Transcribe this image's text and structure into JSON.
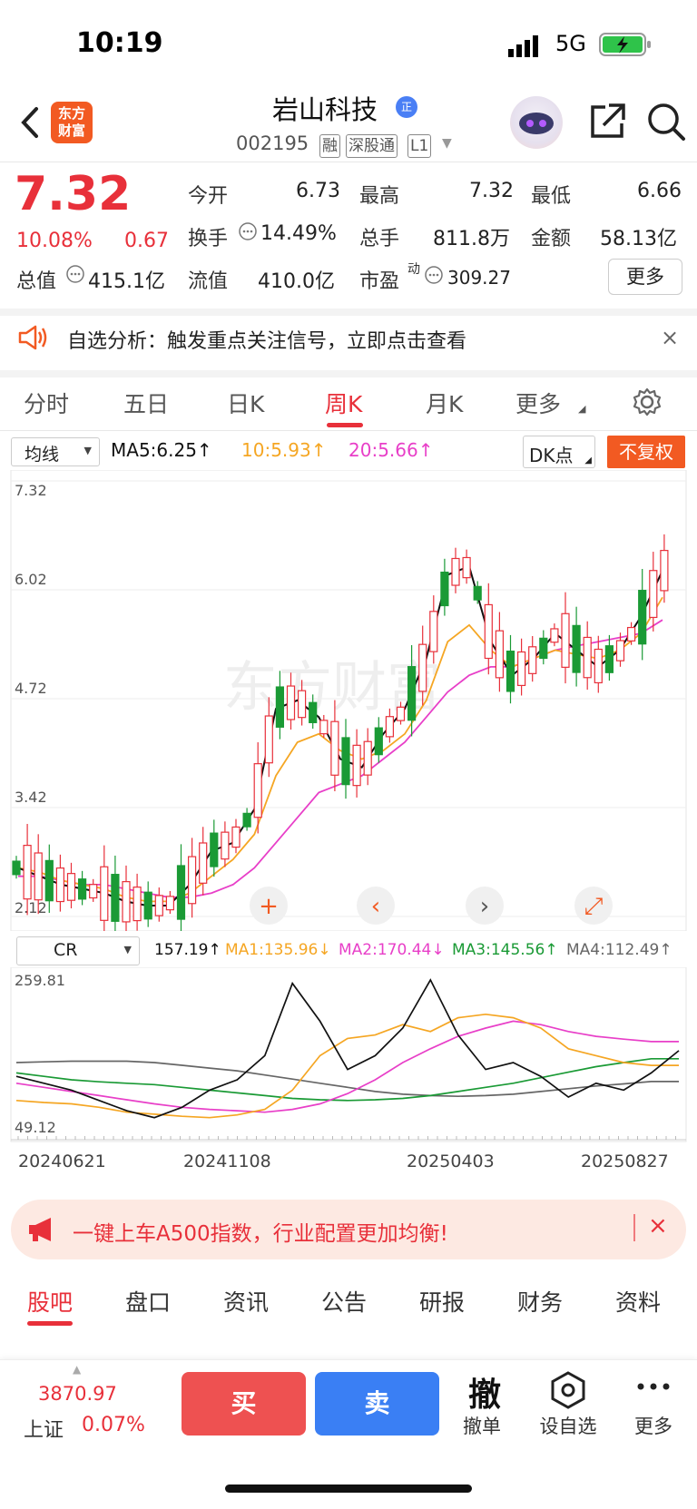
{
  "status": {
    "time": "10:19",
    "network": "5G"
  },
  "header": {
    "logo_line1": "东方",
    "logo_line2": "财富",
    "name": "岩山科技",
    "name_badge": "正",
    "code": "002195",
    "tags": [
      "融",
      "深股通",
      "L1"
    ]
  },
  "quote": {
    "price": "7.32",
    "change_pct": "10.08%",
    "change": "0.67",
    "open_label": "今开",
    "open": "6.73",
    "high_label": "最高",
    "high": "7.32",
    "low_label": "最低",
    "low": "6.66",
    "turnover_label": "换手",
    "turnover": "14.49%",
    "volume_label": "总手",
    "volume": "811.8万",
    "amount_label": "金额",
    "amount": "58.13亿",
    "mcap_label": "总值",
    "mcap": "415.1亿",
    "float_label": "流值",
    "float_cap": "410.0亿",
    "pe_label": "市盈",
    "pe_sup": "动",
    "pe": "309.27",
    "more": "更多"
  },
  "notice": {
    "text": "自选分析：触发重点关注信号，立即点击查看",
    "close": "×"
  },
  "tabs": [
    {
      "label": "分时"
    },
    {
      "label": "五日"
    },
    {
      "label": "日K"
    },
    {
      "label": "周K"
    },
    {
      "label": "月K"
    },
    {
      "label": "更多"
    }
  ],
  "active_tab": "周K",
  "main_chart": {
    "indicator_select": "均线",
    "ma5": "MA5:6.25↑",
    "ma10": "10:5.93↑",
    "ma20": "20:5.66↑",
    "dk_select": "DK点",
    "fq_button": "不复权",
    "y_ticks": [
      "7.32",
      "6.02",
      "4.72",
      "3.42",
      "2.12"
    ],
    "watermark": "东方财富",
    "colors": {
      "up": "#e8303a",
      "down": "#1a9a35",
      "ma5": "#111111",
      "ma10": "#f5a623",
      "ma20": "#e83fc8",
      "t_marker": "#f5a03a",
      "b_marker": "#f07a80"
    }
  },
  "sub_chart": {
    "indicator_select": "CR",
    "cr": "157.19↑",
    "ma1": "MA1:135.96↓",
    "ma2": "MA2:170.44↓",
    "ma3": "MA3:145.56↑",
    "ma4": "MA4:112.49↑",
    "y_ticks": [
      "259.81",
      "49.12"
    ],
    "x_ticks": [
      "20240621",
      "20241108",
      "20250403",
      "20250827"
    ],
    "colors": {
      "cr": "#111111",
      "ma1": "#f5a623",
      "ma2": "#e83fc8",
      "ma3": "#1a9a35",
      "ma4": "#666666"
    }
  },
  "chart_data": [
    {
      "type": "candlestick",
      "title": "",
      "ylim": [
        2.12,
        7.32
      ],
      "y_ticks": [
        "7.32",
        "6.02",
        "4.72",
        "3.42",
        "2.12"
      ],
      "series": [
        {
          "name": "MA5",
          "values": [
            2.7,
            2.6,
            2.5,
            2.45,
            2.4,
            2.3,
            2.25,
            2.25,
            2.5,
            2.9,
            3.0,
            3.4,
            4.6,
            4.7,
            4.5,
            4.0,
            3.9,
            4.3,
            4.6,
            5.2,
            6.2,
            6.3,
            5.4,
            5.0,
            5.2,
            5.5,
            5.3,
            5.1,
            5.3,
            5.7,
            6.25
          ]
        },
        {
          "name": "10",
          "values": [
            2.7,
            2.65,
            2.55,
            2.5,
            2.45,
            2.35,
            2.3,
            2.3,
            2.4,
            2.6,
            2.8,
            3.1,
            3.8,
            4.2,
            4.3,
            4.1,
            4.0,
            4.1,
            4.3,
            4.7,
            5.4,
            5.6,
            5.3,
            5.1,
            5.2,
            5.3,
            5.25,
            5.2,
            5.3,
            5.5,
            5.93
          ]
        },
        {
          "name": "20",
          "values": [
            2.6,
            2.6,
            2.55,
            2.5,
            2.5,
            2.45,
            2.4,
            2.35,
            2.35,
            2.4,
            2.5,
            2.7,
            3.0,
            3.3,
            3.6,
            3.7,
            3.8,
            4.0,
            4.2,
            4.5,
            4.8,
            5.0,
            5.1,
            5.1,
            5.2,
            5.3,
            5.35,
            5.4,
            5.45,
            5.5,
            5.66
          ]
        }
      ]
    },
    {
      "type": "line",
      "title": "",
      "ylim": [
        49.12,
        259.81
      ],
      "x_ticks": [
        "20240621",
        "20241108",
        "20250403",
        "20250827"
      ],
      "series": [
        {
          "name": "CR",
          "values": [
            120,
            110,
            100,
            85,
            70,
            60,
            75,
            100,
            115,
            150,
            255,
            200,
            130,
            150,
            190,
            260,
            180,
            130,
            140,
            120,
            90,
            110,
            100,
            125,
            157.19
          ]
        },
        {
          "name": "MA1",
          "values": [
            85,
            82,
            80,
            75,
            68,
            65,
            62,
            60,
            64,
            72,
            100,
            150,
            175,
            180,
            195,
            185,
            205,
            210,
            205,
            190,
            160,
            150,
            140,
            135.96,
            135.96
          ]
        },
        {
          "name": "MA2",
          "values": [
            110,
            104,
            98,
            92,
            86,
            80,
            75,
            72,
            70,
            68,
            72,
            80,
            95,
            115,
            140,
            160,
            178,
            190,
            200,
            195,
            185,
            178,
            174,
            170.44,
            170.44
          ]
        },
        {
          "name": "MA3",
          "values": [
            125,
            120,
            115,
            112,
            110,
            108,
            104,
            100,
            96,
            92,
            88,
            86,
            85,
            86,
            88,
            92,
            98,
            104,
            110,
            118,
            126,
            134,
            140,
            145.56,
            145.56
          ]
        },
        {
          "name": "MA4",
          "values": [
            140,
            141,
            142,
            142,
            142,
            140,
            136,
            132,
            128,
            122,
            116,
            110,
            104,
            98,
            94,
            92,
            91,
            92,
            94,
            98,
            102,
            106,
            109,
            112.49,
            112.49
          ]
        }
      ]
    }
  ],
  "banner": {
    "text": "一键上车A500指数，行业配置更加均衡!",
    "close": "×"
  },
  "bottom_tabs": [
    {
      "label": "股吧"
    },
    {
      "label": "盘口"
    },
    {
      "label": "资讯"
    },
    {
      "label": "公告"
    },
    {
      "label": "研报"
    },
    {
      "label": "财务"
    },
    {
      "label": "资料"
    }
  ],
  "bottom_bar": {
    "index_value": "3870.97",
    "index_name": "上证",
    "index_change": "0.07%",
    "buy": "买",
    "sell": "卖",
    "cancel_glyph": "撤",
    "cancel": "撤单",
    "watch": "设自选",
    "more": "更多"
  }
}
